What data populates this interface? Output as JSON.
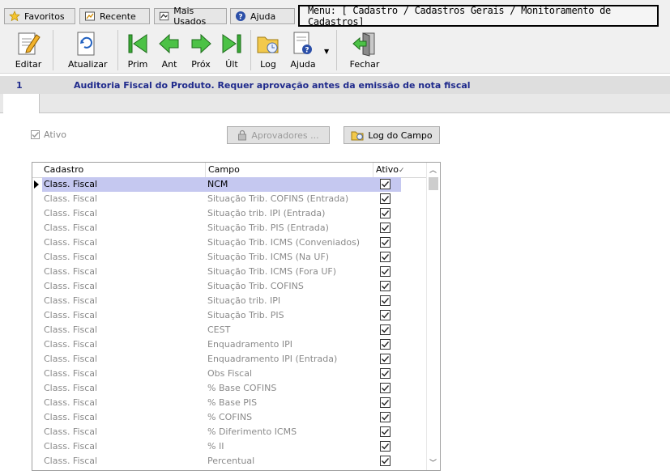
{
  "quick_tabs": [
    {
      "label": "Favoritos",
      "icon": "star-icon"
    },
    {
      "label": "Recente",
      "icon": "recent-icon"
    },
    {
      "label": "Mais Usados",
      "icon": "most-used-icon"
    },
    {
      "label": "Ajuda",
      "icon": "help-icon"
    }
  ],
  "menu_path": "Menu: [ Cadastro / Cadastros Gerais / Monitoramento de Cadastros]",
  "toolbar": {
    "editar": "Editar",
    "atualizar": "Atualizar",
    "prim": "Prim",
    "ant": "Ant",
    "prox": "Próx",
    "ult": "Últ",
    "log": "Log",
    "ajuda": "Ajuda",
    "fechar": "Fechar"
  },
  "header": {
    "id": "1",
    "description": "Auditoria Fiscal do Produto. Requer aprovação antes da emissão de nota fiscal"
  },
  "form": {
    "ativo_label": "Ativo",
    "ativo_checked": true,
    "aprovadores_label": "Aprovadores ...",
    "log_campo_label": "Log do Campo"
  },
  "grid": {
    "columns": [
      "Cadastro",
      "Campo",
      "Ativo"
    ],
    "rows": [
      {
        "cadastro": "Class. Fiscal",
        "campo": "NCM",
        "ativo": true,
        "selected": true
      },
      {
        "cadastro": "Class. Fiscal",
        "campo": "Situação Trib. COFINS (Entrada)",
        "ativo": true
      },
      {
        "cadastro": "Class. Fiscal",
        "campo": "Situação trib. IPI (Entrada)",
        "ativo": true
      },
      {
        "cadastro": "Class. Fiscal",
        "campo": "Situação Trib. PIS (Entrada)",
        "ativo": true
      },
      {
        "cadastro": "Class. Fiscal",
        "campo": "Situação Trib. ICMS (Conveniados)",
        "ativo": true
      },
      {
        "cadastro": "Class. Fiscal",
        "campo": "Situação Trib. ICMS (Na UF)",
        "ativo": true
      },
      {
        "cadastro": "Class. Fiscal",
        "campo": "Situação Trib. ICMS (Fora UF)",
        "ativo": true
      },
      {
        "cadastro": "Class. Fiscal",
        "campo": "Situação Trib. COFINS",
        "ativo": true
      },
      {
        "cadastro": "Class. Fiscal",
        "campo": "Situação trib. IPI",
        "ativo": true
      },
      {
        "cadastro": "Class. Fiscal",
        "campo": "Situação Trib. PIS",
        "ativo": true
      },
      {
        "cadastro": "Class. Fiscal",
        "campo": "CEST",
        "ativo": true
      },
      {
        "cadastro": "Class. Fiscal",
        "campo": "Enquadramento IPI",
        "ativo": true
      },
      {
        "cadastro": "Class. Fiscal",
        "campo": "Enquadramento IPI (Entrada)",
        "ativo": true
      },
      {
        "cadastro": "Class. Fiscal",
        "campo": "Obs Fiscal",
        "ativo": true
      },
      {
        "cadastro": "Class. Fiscal",
        "campo": "% Base COFINS",
        "ativo": true
      },
      {
        "cadastro": "Class. Fiscal",
        "campo": "% Base PIS",
        "ativo": true
      },
      {
        "cadastro": "Class. Fiscal",
        "campo": "% COFINS",
        "ativo": true
      },
      {
        "cadastro": "Class. Fiscal",
        "campo": "% Diferimento ICMS",
        "ativo": true
      },
      {
        "cadastro": "Class. Fiscal",
        "campo": "% II",
        "ativo": true
      },
      {
        "cadastro": "Class. Fiscal",
        "campo": "Percentual",
        "ativo": true
      }
    ]
  }
}
